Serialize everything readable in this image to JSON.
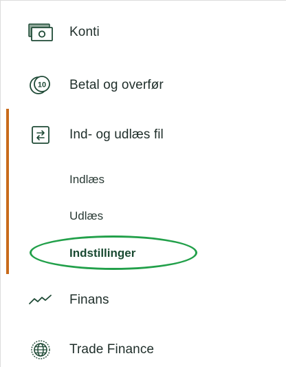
{
  "nav": {
    "items": [
      {
        "label": "Konti",
        "icon": "accounts-icon"
      },
      {
        "label": "Betal og overfør",
        "icon": "coin-10-icon"
      },
      {
        "label": "Ind- og udlæs fil",
        "icon": "transfer-arrows-icon",
        "active": true
      },
      {
        "label": "Finans",
        "icon": "trend-line-icon"
      },
      {
        "label": "Trade Finance",
        "icon": "globe-icon"
      }
    ],
    "subitems": [
      {
        "label": "Indlæs"
      },
      {
        "label": "Udlæs"
      },
      {
        "label": "Indstillinger",
        "selected": true
      }
    ]
  },
  "colors": {
    "active_bar": "#c86a1a",
    "icon": "#1f4a36",
    "highlight": "#22a04a"
  }
}
